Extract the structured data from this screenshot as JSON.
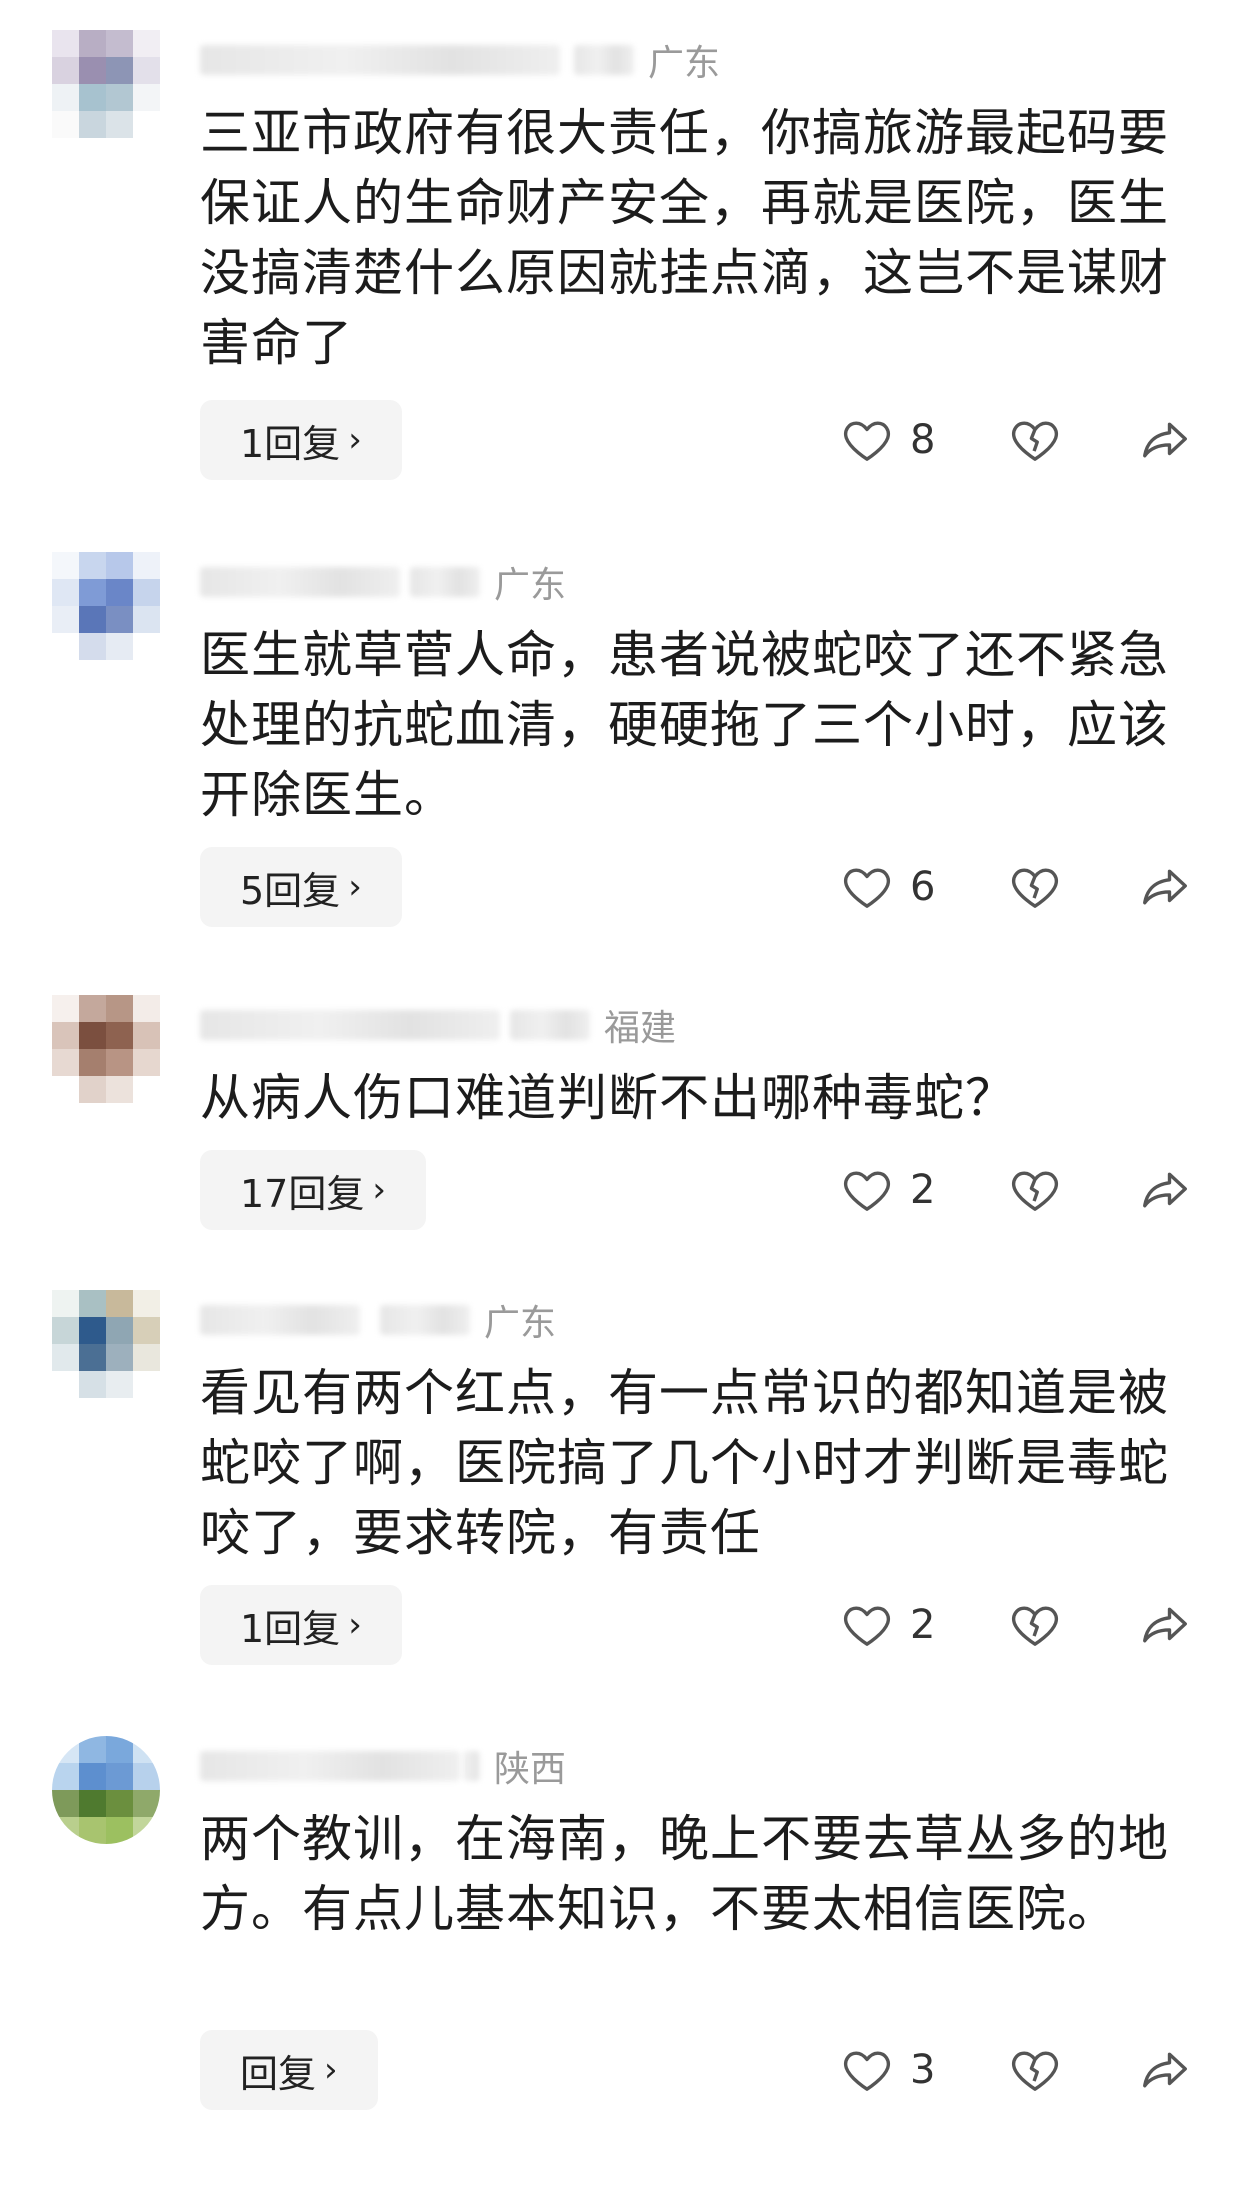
{
  "reply_suffix": "回复",
  "chevron": "›",
  "icons": {
    "like": "heart-outline-icon",
    "dislike": "broken-heart-icon",
    "share": "share-arrow-icon"
  },
  "comments": [
    {
      "location": "广东",
      "text": "三亚市政府有很大责任，你搞旅游最起码要保证人的生命财产安全，再就是医院，医生没搞清楚什么原因就挂点滴，这岂不是谋财害命了",
      "replies": "1回复",
      "likes": "8"
    },
    {
      "location": "广东",
      "text": "医生就草菅人命，患者说被蛇咬了还不紧急处理的抗蛇血清，硬硬拖了三个小时，应该开除医生。",
      "replies": "5回复",
      "likes": "6"
    },
    {
      "location": "福建",
      "text": "从病人伤口难道判断不出哪种毒蛇？",
      "replies": "17回复",
      "likes": "2"
    },
    {
      "location": "广东",
      "text": "看见有两个红点，有一点常识的都知道是被蛇咬了啊，医院搞了几个小时才判断是毒蛇咬了，要求转院，有责任",
      "replies": "1回复",
      "likes": "2"
    },
    {
      "location": "陕西",
      "text": "两个教训，在海南，晚上不要去草丛多的地方。有点儿基本知识，不要太相信医院。",
      "replies": "回复",
      "likes": "3"
    }
  ]
}
